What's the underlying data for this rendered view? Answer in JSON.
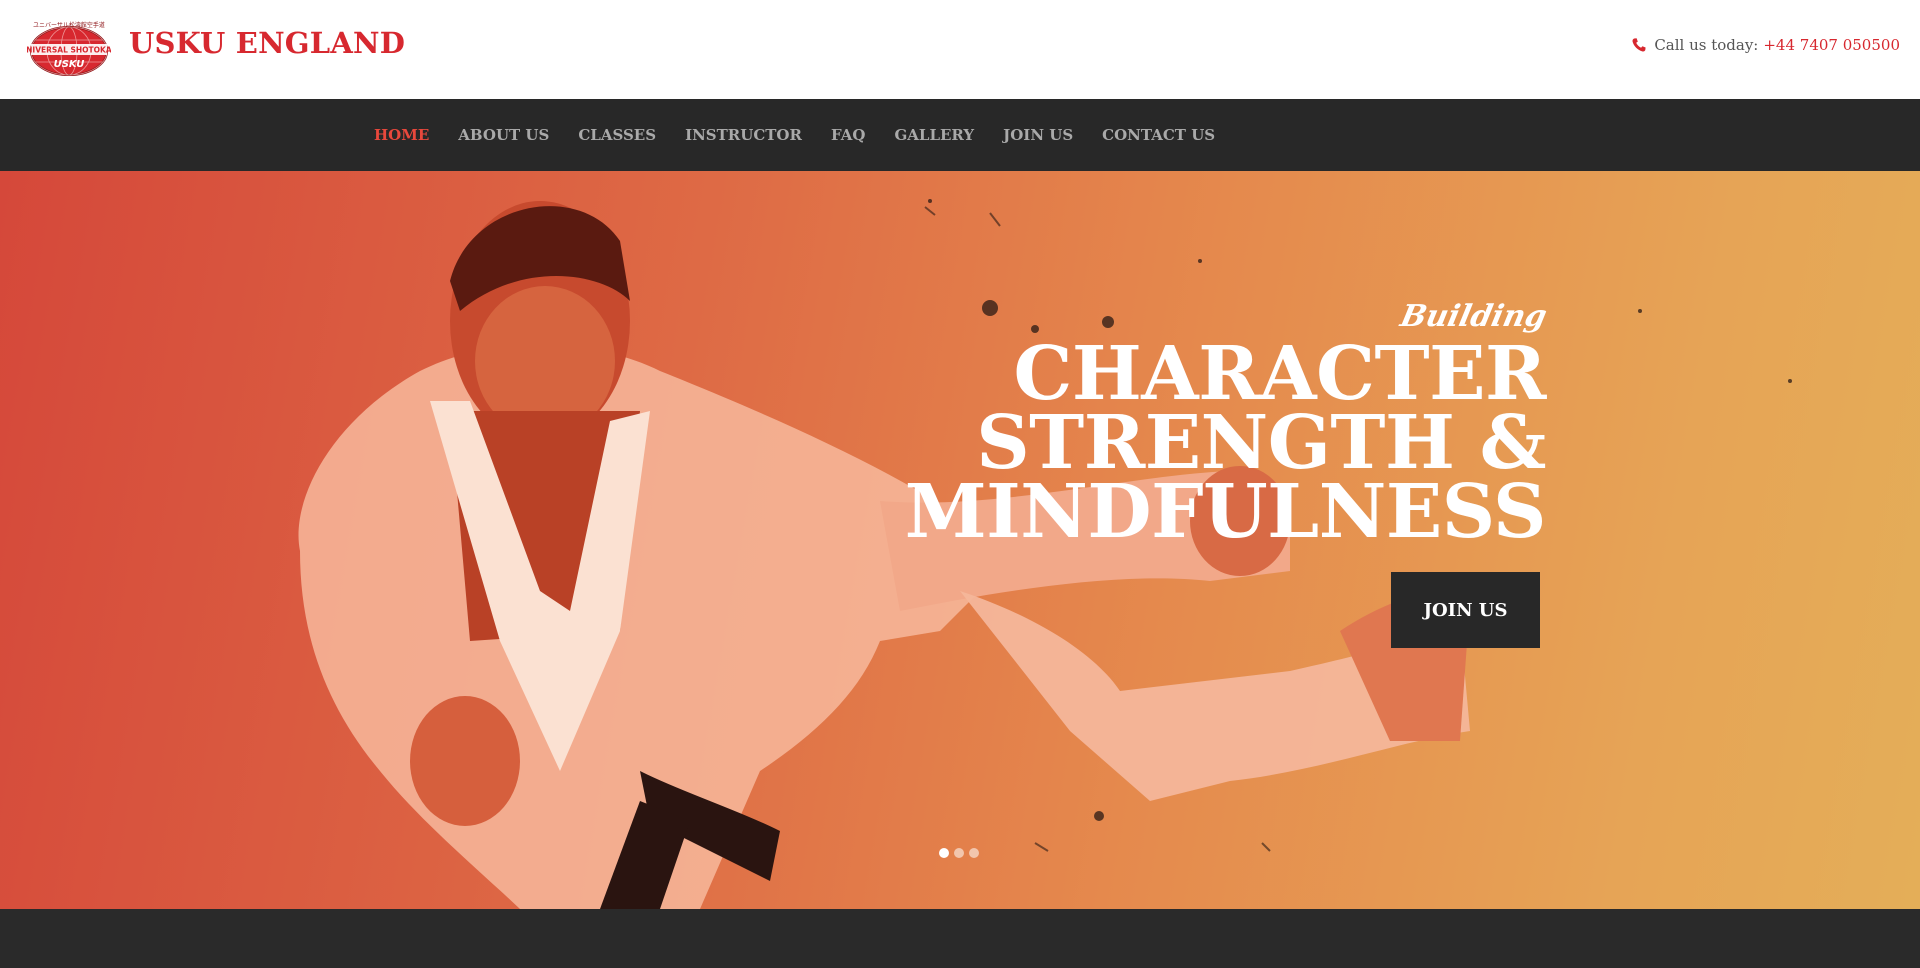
{
  "header": {
    "brand": "USKU ENGLAND",
    "logo": {
      "top_text": "ユニバーサル松濤館空手道",
      "middle_text": "UNIVERSAL SHOTOKAN",
      "bottom_text": "USKU",
      "colors": {
        "primary": "#d7282f",
        "dark": "#8c1114",
        "white": "#ffffff"
      }
    },
    "call_label": "Call us today:",
    "phone": "+44 7407 050500",
    "phone_icon": "phone-icon"
  },
  "nav": {
    "items": [
      {
        "label": "HOME",
        "active": true
      },
      {
        "label": "ABOUT US",
        "active": false
      },
      {
        "label": "CLASSES",
        "active": false
      },
      {
        "label": "INSTRUCTOR",
        "active": false
      },
      {
        "label": "FAQ",
        "active": false
      },
      {
        "label": "GALLERY",
        "active": false
      },
      {
        "label": "JOIN US",
        "active": false
      },
      {
        "label": "CONTACT US",
        "active": false
      }
    ]
  },
  "hero": {
    "kicker": "Building",
    "headline_lines": [
      "CHARACTER",
      "STRENGTH &",
      "MINDFULNESS"
    ],
    "cta_label": "JOIN US",
    "slides": 3,
    "active_slide": 0
  },
  "colors": {
    "accent": "#d7282f",
    "nav_active": "#e8483c",
    "nav_bg": "#282828",
    "hero_gradient_start": "#d5483a",
    "hero_gradient_end": "#e4ae58"
  }
}
